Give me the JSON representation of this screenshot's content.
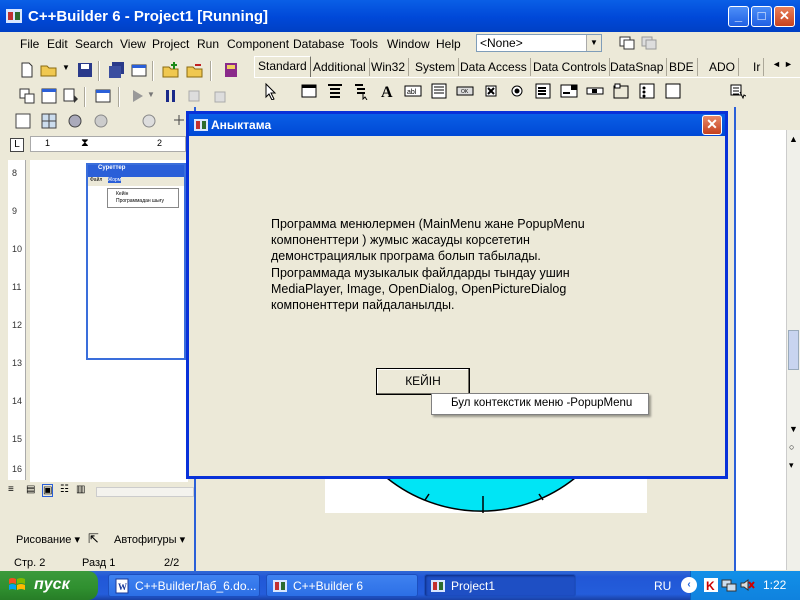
{
  "ide": {
    "title": "C++Builder 6 - Project1 [Running]",
    "menu": [
      "File",
      "Edit",
      "Search",
      "View",
      "Project",
      "Run",
      "Component",
      "Database",
      "Tools",
      "Window",
      "Help"
    ],
    "target_combo": "<None>",
    "palette_tabs": [
      "Standard",
      "Additional",
      "Win32",
      "System",
      "Data Access",
      "Data Controls",
      "DataSnap",
      "BDE",
      "ADO",
      "Ir"
    ],
    "active_tab": "Standard"
  },
  "word": {
    "thumbnail": {
      "title": "Суреттер",
      "menu": [
        "Файл",
        "Жорм"
      ],
      "popup": [
        "Кейін",
        "Программадан шығу"
      ]
    },
    "ruler_numbers": [
      "1",
      "2"
    ],
    "vertical_ruler": [
      "8",
      "9",
      "10",
      "11",
      "12",
      "13",
      "14",
      "15",
      "16"
    ],
    "drawing_label": "Рисование",
    "autoshapes_label": "Автофигуры",
    "status": {
      "page": "Стр. 2",
      "section": "Разд 1",
      "pages": "2/2"
    }
  },
  "dialog": {
    "title": "Аныктама",
    "text": "Программа  менюлермен (MainMenu жане PopupMenu\nкомпоненттери ) жумыс жасауды корсететин\nдемонстрациялык програма болып табылады.\nПрограммада  музыкалык файлдарды тындау ушин\nMediaPlayer,  Image, OpenDialog, OpenPictureDialog\nкомпоненттери пайдаланылды.",
    "button": "КЕЙІН",
    "popup_item": "Бул контекстик меню -PopupMenu"
  },
  "taskbar": {
    "start": "пуск",
    "tasks": [
      "C++BuilderЛаб_6.do...",
      "C++Builder 6",
      "Project1"
    ],
    "active_task": "Project1",
    "lang": "RU",
    "clock": "1:22"
  },
  "colors": {
    "xp_blue": "#0a5fe6",
    "dialog_bg": "#ece9d8",
    "start_green": "#2f8f2f",
    "arc_cyan": "#00e5f5"
  }
}
